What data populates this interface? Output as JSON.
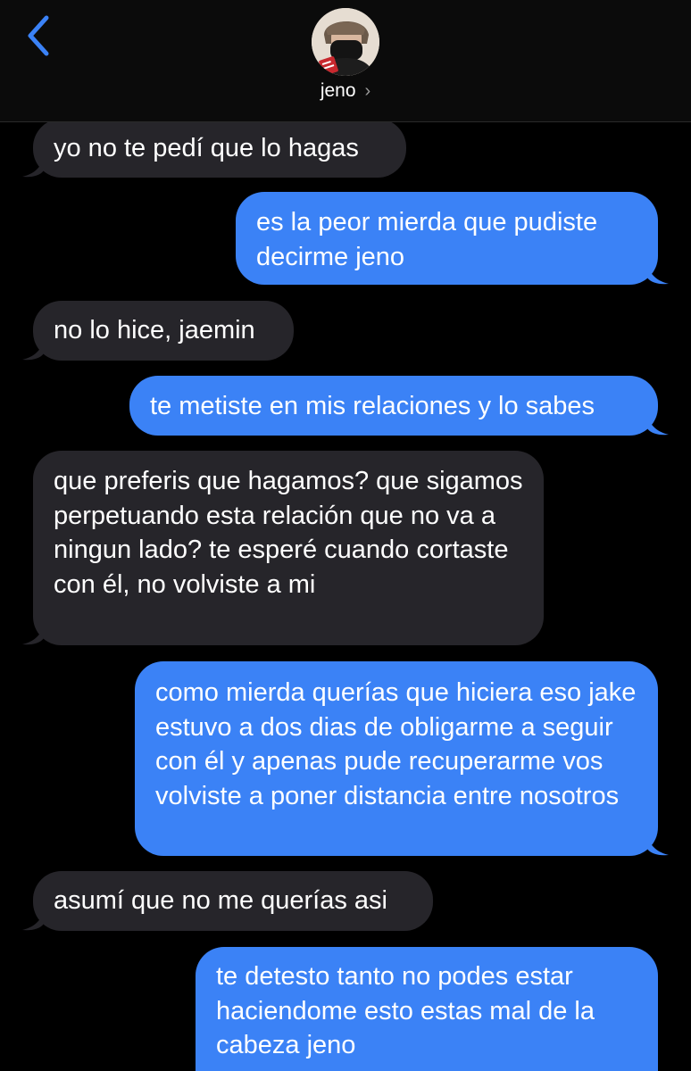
{
  "header": {
    "contact_name": "jeno",
    "colors": {
      "accent": "#3b82f6",
      "header_bg": "#0b0b0b"
    }
  },
  "messages": [
    {
      "direction": "incoming",
      "text": "yo no te pedí que lo hagas"
    },
    {
      "direction": "outgoing",
      "text": "es la peor mierda que pudiste decirme jeno"
    },
    {
      "direction": "incoming",
      "text": "no lo hice, jaemin"
    },
    {
      "direction": "outgoing",
      "text": "te metiste en mis relaciones y lo sabes"
    },
    {
      "direction": "incoming",
      "text": "que preferis que hagamos? que sigamos perpetuando esta relación que no va a ningun lado? te esperé cuando cortaste con él, no volviste a mi"
    },
    {
      "direction": "outgoing",
      "text": "como mierda querías que hiciera eso jake estuvo a dos dias de obligarme a seguir con él y apenas pude recuperarme vos volviste a poner distancia entre nosotros"
    },
    {
      "direction": "incoming",
      "text": "asumí que no me querías asi"
    },
    {
      "direction": "outgoing",
      "text": "te detesto tanto no podes estar haciendome esto estas mal de la cabeza jeno"
    }
  ],
  "colors": {
    "incoming_bubble": "#26252a",
    "outgoing_bubble": "#3b82f6",
    "background": "#000000"
  }
}
